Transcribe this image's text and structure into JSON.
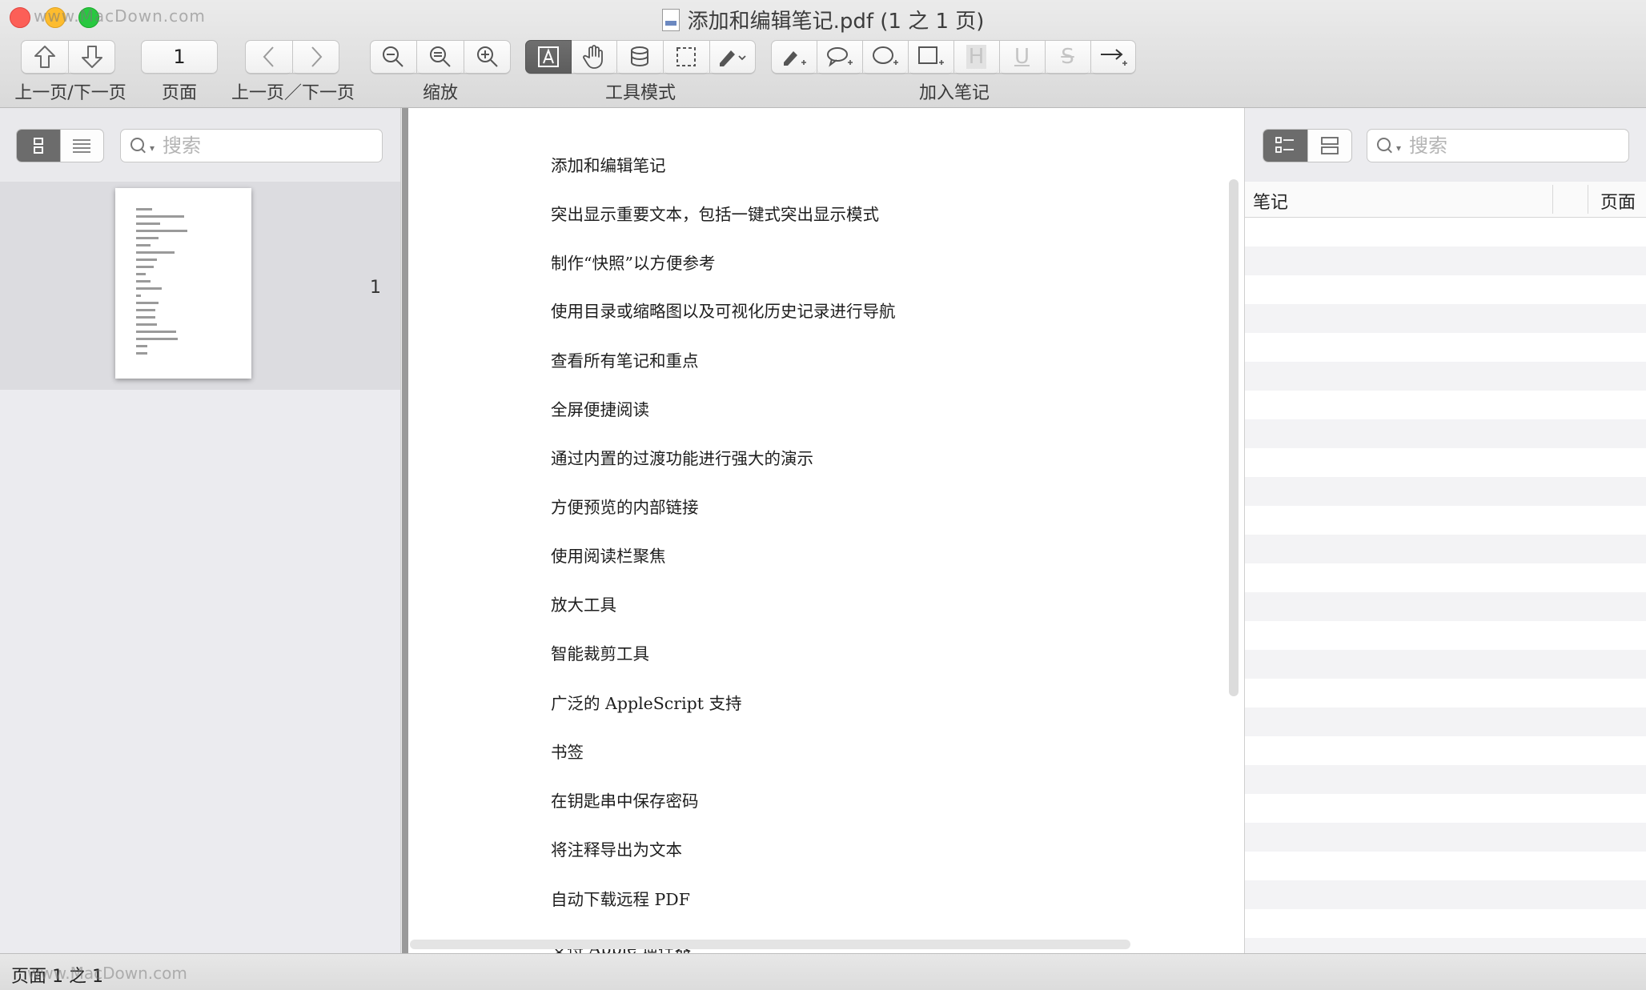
{
  "window": {
    "title": "添加和编辑笔记.pdf (1 之 1 页)",
    "watermark": "www.MacDown.com"
  },
  "toolbar": {
    "page_number": "1",
    "labels": {
      "prev_next_page": "上一页/下一页",
      "page": "页面",
      "back_forward": "上一页／下一页",
      "zoom": "缩放",
      "tool_mode": "工具模式",
      "add_notes": "加入笔记"
    },
    "icons": {
      "page_up": "arrow-up-icon",
      "page_down": "arrow-down-icon",
      "back": "chevron-left-icon",
      "forward": "chevron-right-icon",
      "zoom_out_small": "zoom-out-icon",
      "zoom_fit": "zoom-actual-icon",
      "zoom_in": "zoom-in-icon",
      "text_tool": "text-select-icon",
      "hand_tool": "hand-icon",
      "magnify_tool": "loupe-icon",
      "select_tool": "marquee-icon",
      "pen_tool": "pen-icon",
      "add_highlight_note": "highlighter-plus-icon",
      "add_comment": "speech-bubble-plus-icon",
      "add_oval": "oval-plus-icon",
      "add_rect": "rectangle-plus-icon",
      "add_highlight": "highlight-h-icon",
      "add_underline": "underline-u-icon",
      "add_strike": "strike-s-icon",
      "add_arrow": "arrow-line-icon"
    },
    "highlight_glyph": "H",
    "underline_glyph": "U",
    "strike_glyph": "S"
  },
  "left_sidebar": {
    "search_placeholder": "搜索",
    "thumbnail_page_number": "1"
  },
  "document": {
    "lines": [
      "添加和编辑笔记",
      "突出显示重要文本，包括一键式突出显示模式",
      "制作“快照”以方便参考",
      "使用目录或缩略图以及可视化历史记录进行导航",
      "查看所有笔记和重点",
      "全屏便捷阅读",
      "通过内置的过渡功能进行强大的演示",
      "方便预览的内部链接",
      "使用阅读栏聚焦",
      "放大工具",
      "智能裁剪工具",
      "广泛的 AppleScript 支持",
      "书签",
      "在钥匙串中保存密码",
      "将注释导出为文本",
      "自动下载远程 PDF",
      "支持 Apple 遥控器"
    ]
  },
  "right_sidebar": {
    "search_placeholder": "搜索",
    "columns": {
      "notes": "笔记",
      "page": "页面"
    }
  },
  "statusbar": {
    "text": "页面 1 之 1"
  },
  "colors": {
    "traffic_close": "#fc5f57",
    "traffic_minimize": "#fdbc2e",
    "traffic_zoom": "#28c840",
    "active_segment": "#6c6c6c"
  }
}
